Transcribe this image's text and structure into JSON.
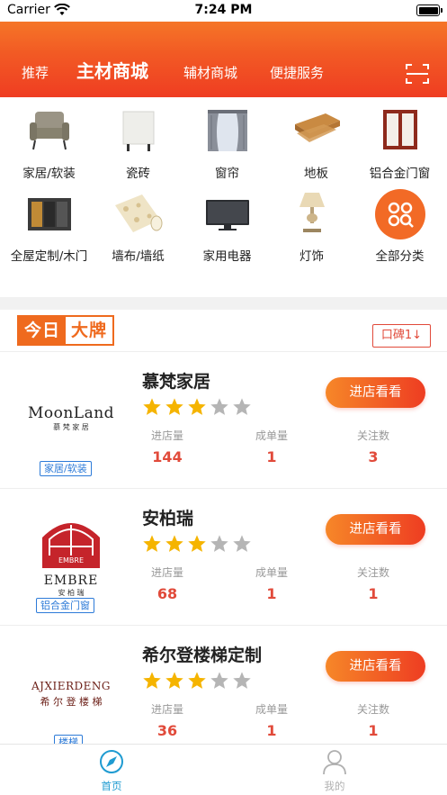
{
  "status_bar": {
    "carrier": "Carrier",
    "time": "7:24 PM"
  },
  "top_nav": {
    "tabs": [
      {
        "label": "推荐"
      },
      {
        "label": "主材商城"
      },
      {
        "label": "辅材商城"
      },
      {
        "label": "便捷服务"
      }
    ],
    "scan_icon": "scan-icon"
  },
  "categories": [
    {
      "label": "家居/软装",
      "icon": "armchair"
    },
    {
      "label": "瓷砖",
      "icon": "tile"
    },
    {
      "label": "窗帘",
      "icon": "curtain"
    },
    {
      "label": "地板",
      "icon": "floor-plank"
    },
    {
      "label": "铝合金门窗",
      "icon": "window-frame"
    },
    {
      "label": "全屋定制/木门",
      "icon": "wardrobe"
    },
    {
      "label": "墙布/墙纸",
      "icon": "wallpaper-roll"
    },
    {
      "label": "家用电器",
      "icon": "tv"
    },
    {
      "label": "灯饰",
      "icon": "table-lamp"
    },
    {
      "label": "全部分类",
      "icon": "all-categories"
    }
  ],
  "brand_section": {
    "title_part1": "今日",
    "title_part2": "大牌",
    "sort_label": "口碑1↓"
  },
  "stat_labels": {
    "visits": "进店量",
    "deals": "成单量",
    "followers": "关注数"
  },
  "shops": [
    {
      "name": "慕梵家居",
      "tag": "家居/软装",
      "rating": 3,
      "visits": "144",
      "deals": "1",
      "followers": "3",
      "enter_label": "进店看看",
      "logo_line1": "MoonLand",
      "logo_line2": "慕 梵 家 居"
    },
    {
      "name": "安柏瑞",
      "tag": "铝合金门窗",
      "rating": 3,
      "visits": "68",
      "deals": "1",
      "followers": "1",
      "enter_label": "进店看看",
      "logo_line1": "EMBRE",
      "logo_line2": "安 柏 瑞",
      "logo_badge": "EMBRE"
    },
    {
      "name": "希尔登楼梯定制",
      "tag": "楼梯",
      "rating": 3,
      "visits": "36",
      "deals": "1",
      "followers": "1",
      "enter_label": "进店看看",
      "logo_line1": "AJXIERDENG",
      "logo_line2": "希 尔 登 楼 梯"
    }
  ],
  "tab_bar": {
    "items": [
      {
        "label": "首页",
        "icon": "compass-icon",
        "active": true
      },
      {
        "label": "我的",
        "icon": "user-icon",
        "active": false
      }
    ]
  },
  "colors": {
    "accent": "#ef3d22",
    "accent_orange": "#f68728",
    "tag_blue": "#2d7bd8",
    "star": "#f5b400",
    "active_tab": "#1f9bd1"
  }
}
